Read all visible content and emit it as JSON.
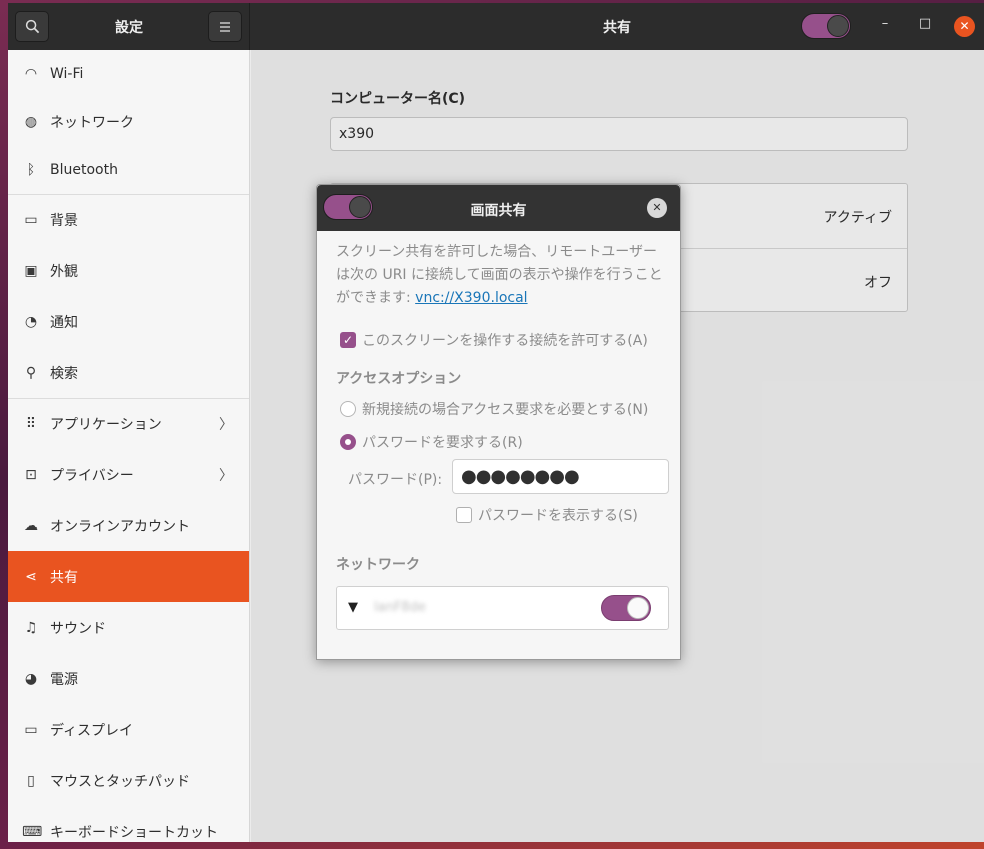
{
  "header": {
    "sidebar_title": "設定",
    "main_title": "共有",
    "search_icon": "search-icon",
    "menu_icon": "hamburger-menu-icon",
    "sharing_toggle_on": true,
    "minimize": "–",
    "maximize": "□",
    "close": "✕"
  },
  "sidebar": {
    "items": [
      {
        "label": "Wi-Fi",
        "icon": "wifi-icon",
        "glyph": "◠"
      },
      {
        "label": "ネットワーク",
        "icon": "network-icon",
        "glyph": "◍"
      },
      {
        "label": "Bluetooth",
        "icon": "bluetooth-icon",
        "glyph": "ᛒ"
      },
      {
        "label": "背景",
        "icon": "background-icon",
        "glyph": "▭"
      },
      {
        "label": "外観",
        "icon": "appearance-icon",
        "glyph": "▣"
      },
      {
        "label": "通知",
        "icon": "notification-bell-icon",
        "glyph": "◔"
      },
      {
        "label": "検索",
        "icon": "search-icon",
        "glyph": "⚲"
      },
      {
        "label": "アプリケーション",
        "icon": "applications-grid-icon",
        "glyph": "⠿",
        "chevron": "〉"
      },
      {
        "label": "プライバシー",
        "icon": "lock-icon",
        "glyph": "⊡",
        "chevron": "〉"
      },
      {
        "label": "オンラインアカウント",
        "icon": "cloud-icon",
        "glyph": "☁"
      },
      {
        "label": "共有",
        "icon": "share-icon",
        "glyph": "⋖"
      },
      {
        "label": "サウンド",
        "icon": "music-note-icon",
        "glyph": "♫"
      },
      {
        "label": "電源",
        "icon": "power-icon",
        "glyph": "◕"
      },
      {
        "label": "ディスプレイ",
        "icon": "display-icon",
        "glyph": "▭"
      },
      {
        "label": "マウスとタッチパッド",
        "icon": "mouse-icon",
        "glyph": "▯"
      },
      {
        "label": "キーボードショートカット",
        "icon": "keyboard-icon",
        "glyph": "⌨"
      }
    ]
  },
  "main": {
    "computer_name_label": "コンピューター名(C)",
    "computer_name_value": "x390",
    "services": [
      {
        "status": "アクティブ"
      },
      {
        "status": "オフ"
      }
    ]
  },
  "dialog": {
    "title": "画面共有",
    "description": "スクリーン共有を許可した場合、リモートユーザーは次の URI に接続して画面の表示や操作を行うことができます: ",
    "uri": "vnc://X390.local",
    "allow_control_label": "このスクリーンを操作する接続を許可する(A)",
    "allow_control_checked": true,
    "access_options_title": "アクセスオプション",
    "option_new_conn": "新規接続の場合アクセス要求を必要とする(N)",
    "option_password": "パスワードを要求する(R)",
    "selected_option": "option_password",
    "password_label": "パスワード(P):",
    "password_value": "●●●●●●●●",
    "show_password_label": "パスワードを表示する(S)",
    "show_password_checked": false,
    "network_title": "ネットワーク",
    "network_name": "lanF8de",
    "network_enabled": true
  },
  "colors": {
    "accent": "#e95420",
    "toggle_on": "#96508b",
    "header_bg": "#2c2c2c"
  }
}
